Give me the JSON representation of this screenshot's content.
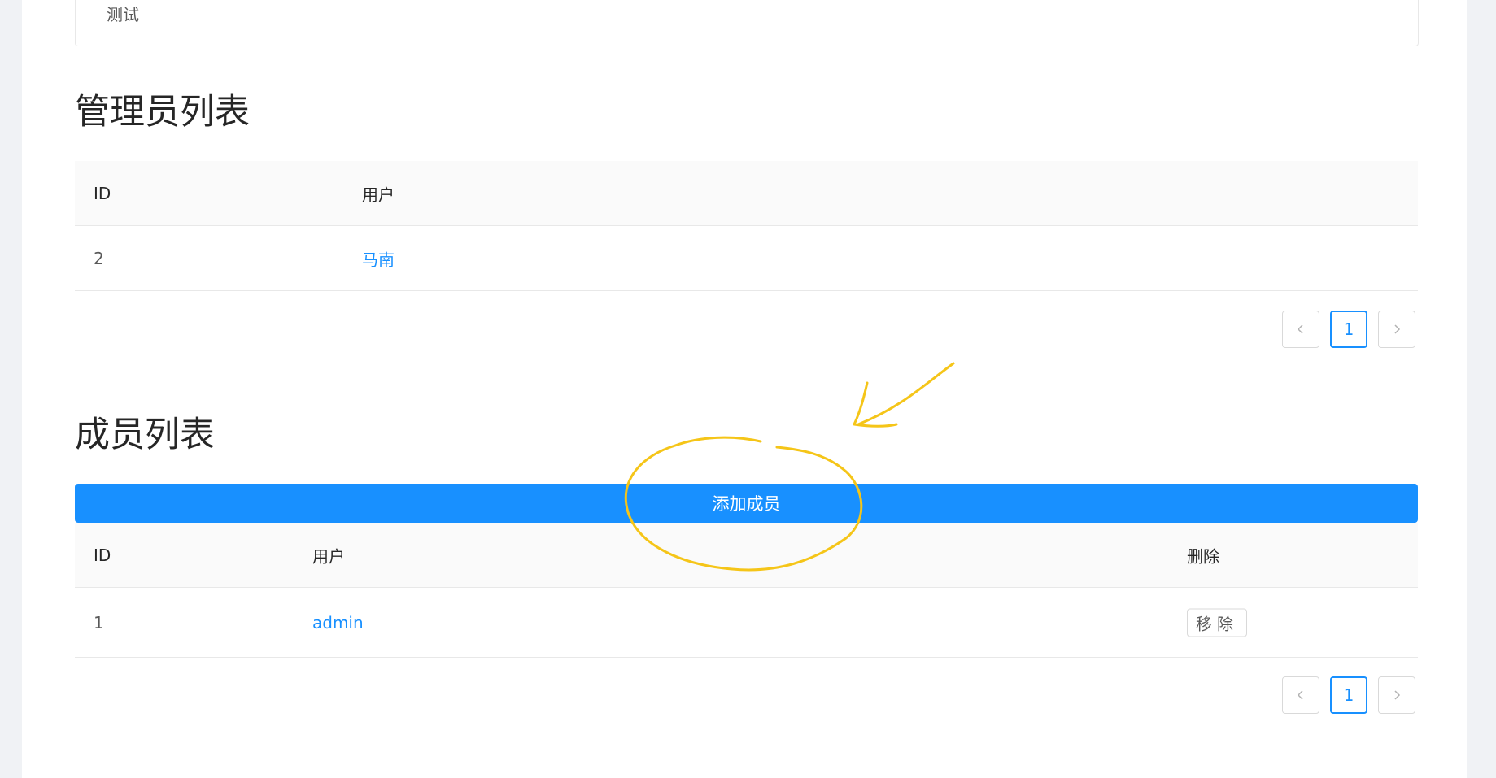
{
  "top_box": {
    "text": "测试"
  },
  "admin_section": {
    "title": "管理员列表",
    "columns": {
      "id": "ID",
      "user": "用户"
    },
    "rows": [
      {
        "id": "2",
        "user": "马南"
      }
    ],
    "pagination": {
      "current": "1"
    }
  },
  "member_section": {
    "title": "成员列表",
    "add_button": "添加成员",
    "columns": {
      "id": "ID",
      "user": "用户",
      "delete": "删除"
    },
    "rows": [
      {
        "id": "1",
        "user": "admin",
        "action": "移除"
      }
    ],
    "pagination": {
      "current": "1"
    }
  },
  "annotation": {
    "color": "#f5c518"
  },
  "colors": {
    "primary": "#1890ff",
    "background": "#f0f2f5"
  }
}
